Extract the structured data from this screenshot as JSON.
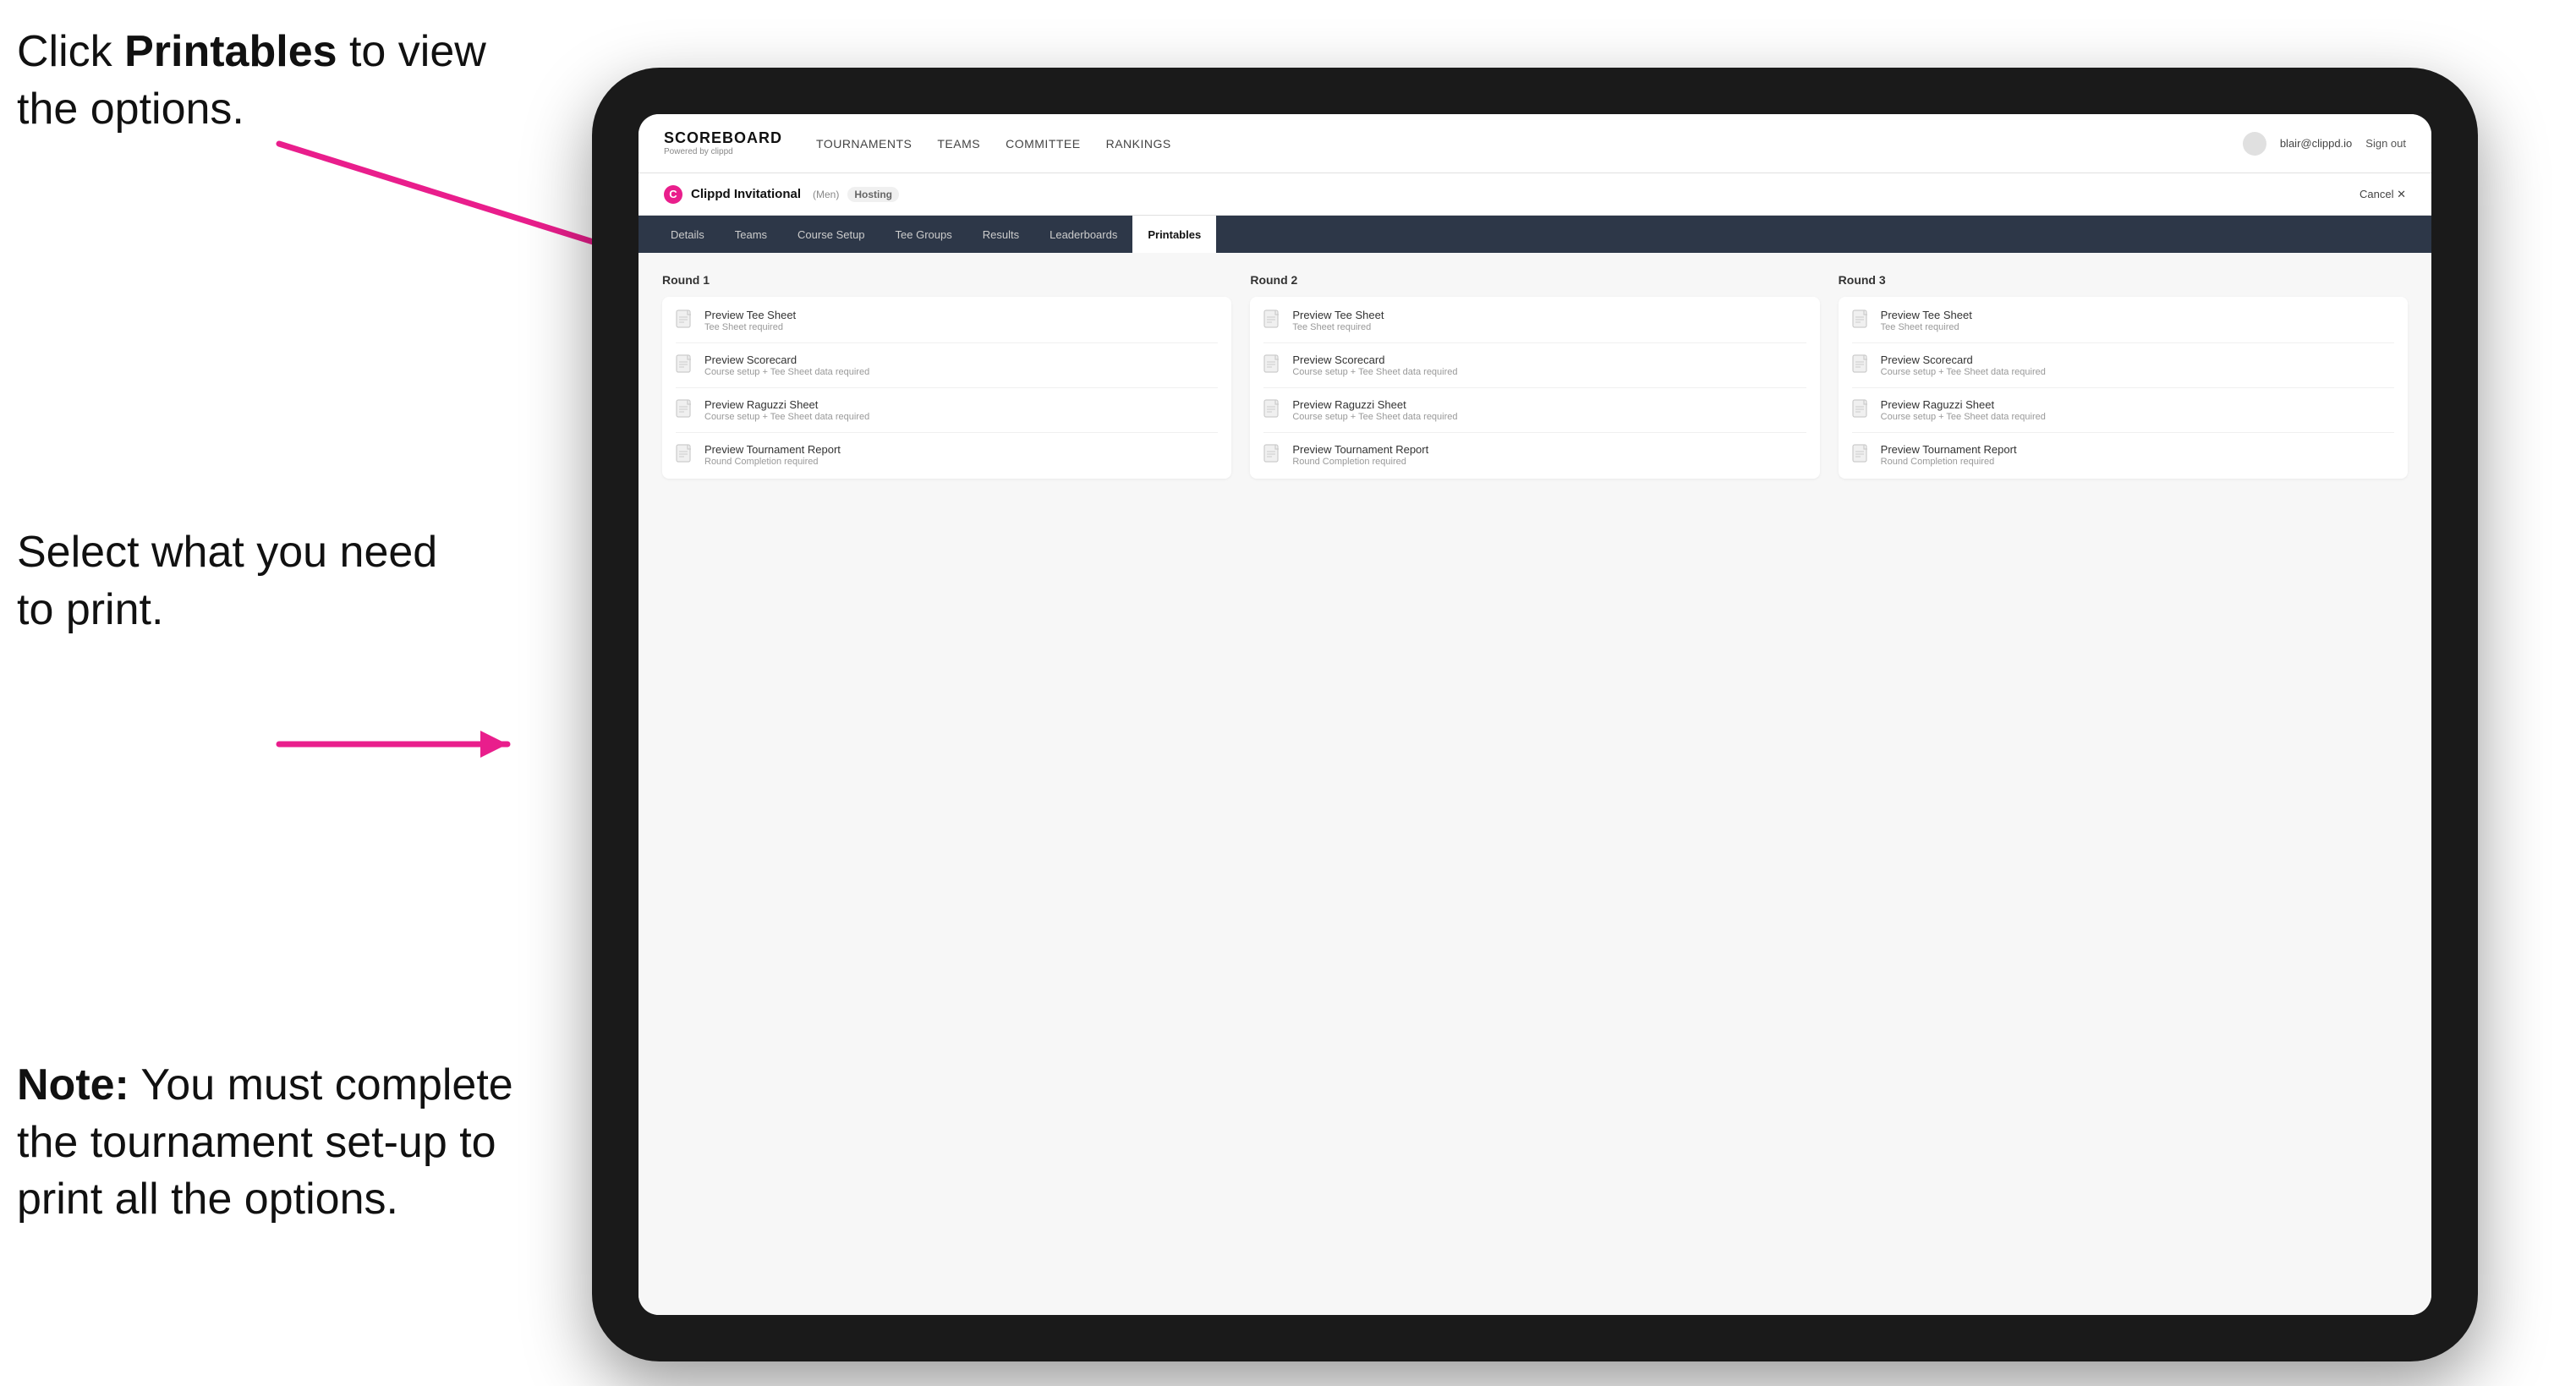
{
  "annotations": {
    "top": "Click Printables to view the options.",
    "middle": "Select what you need to print.",
    "bottom_bold": "Note:",
    "bottom_text": " You must complete the tournament set-up to print all the options."
  },
  "nav": {
    "logo_title": "SCOREBOARD",
    "logo_subtitle": "Powered by clippd",
    "items": [
      {
        "label": "TOURNAMENTS",
        "active": false
      },
      {
        "label": "TEAMS",
        "active": false
      },
      {
        "label": "COMMITTEE",
        "active": false
      },
      {
        "label": "RANKINGS",
        "active": false
      }
    ],
    "user_email": "blair@clippd.io",
    "sign_out": "Sign out"
  },
  "tournament": {
    "name": "Clippd Invitational",
    "badge": "(Men)",
    "hosting": "Hosting",
    "cancel": "Cancel ✕"
  },
  "sub_nav": {
    "items": [
      {
        "label": "Details",
        "active": false
      },
      {
        "label": "Teams",
        "active": false
      },
      {
        "label": "Course Setup",
        "active": false
      },
      {
        "label": "Tee Groups",
        "active": false
      },
      {
        "label": "Results",
        "active": false
      },
      {
        "label": "Leaderboards",
        "active": false
      },
      {
        "label": "Printables",
        "active": true
      }
    ]
  },
  "rounds": [
    {
      "title": "Round 1",
      "items": [
        {
          "title": "Preview Tee Sheet",
          "subtitle": "Tee Sheet required"
        },
        {
          "title": "Preview Scorecard",
          "subtitle": "Course setup + Tee Sheet data required"
        },
        {
          "title": "Preview Raguzzi Sheet",
          "subtitle": "Course setup + Tee Sheet data required"
        },
        {
          "title": "Preview Tournament Report",
          "subtitle": "Round Completion required"
        }
      ]
    },
    {
      "title": "Round 2",
      "items": [
        {
          "title": "Preview Tee Sheet",
          "subtitle": "Tee Sheet required"
        },
        {
          "title": "Preview Scorecard",
          "subtitle": "Course setup + Tee Sheet data required"
        },
        {
          "title": "Preview Raguzzi Sheet",
          "subtitle": "Course setup + Tee Sheet data required"
        },
        {
          "title": "Preview Tournament Report",
          "subtitle": "Round Completion required"
        }
      ]
    },
    {
      "title": "Round 3",
      "items": [
        {
          "title": "Preview Tee Sheet",
          "subtitle": "Tee Sheet required"
        },
        {
          "title": "Preview Scorecard",
          "subtitle": "Course setup + Tee Sheet data required"
        },
        {
          "title": "Preview Raguzzi Sheet",
          "subtitle": "Course setup + Tee Sheet data required"
        },
        {
          "title": "Preview Tournament Report",
          "subtitle": "Round Completion required"
        }
      ]
    }
  ]
}
